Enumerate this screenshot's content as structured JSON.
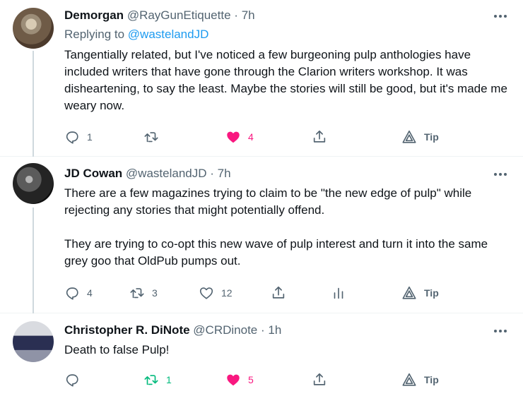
{
  "tweets": [
    {
      "name": "Demorgan",
      "handle": "@RayGunEtiquette",
      "dot": "·",
      "time": "7h",
      "replying_prefix": "Replying to ",
      "replying_to": "@wastelandJD",
      "text": "Tangentially related, but I've noticed a few burgeoning pulp anthologies have included writers that have gone through the Clarion writers workshop. It was disheartening, to say the least. Maybe the stories will still be good, but it's made me weary now.",
      "replies": "1",
      "retweets": "",
      "likes": "4",
      "tip": "Tip",
      "liked": true
    },
    {
      "name": "JD Cowan",
      "handle": "@wastelandJD",
      "dot": "·",
      "time": "7h",
      "text": "There are a few magazines trying to claim to be \"the new edge of pulp\" while rejecting any stories that might potentially offend.\n\nThey are trying to co-opt this new wave of pulp interest and turn it into the same grey goo that OldPub pumps out.",
      "replies": "4",
      "retweets": "3",
      "likes": "12",
      "tip": "Tip",
      "liked": false
    },
    {
      "name": "Christopher R. DiNote",
      "handle": "@CRDinote",
      "dot": "·",
      "time": "1h",
      "text": "Death to false Pulp!",
      "replies": "",
      "retweets": "1",
      "likes": "5",
      "tip": "Tip",
      "liked": true
    }
  ],
  "colors": {
    "text": "#0f1419",
    "secondary": "#536471",
    "link": "#1d9bf0",
    "like": "#f91880",
    "retweet": "#00ba7c"
  }
}
